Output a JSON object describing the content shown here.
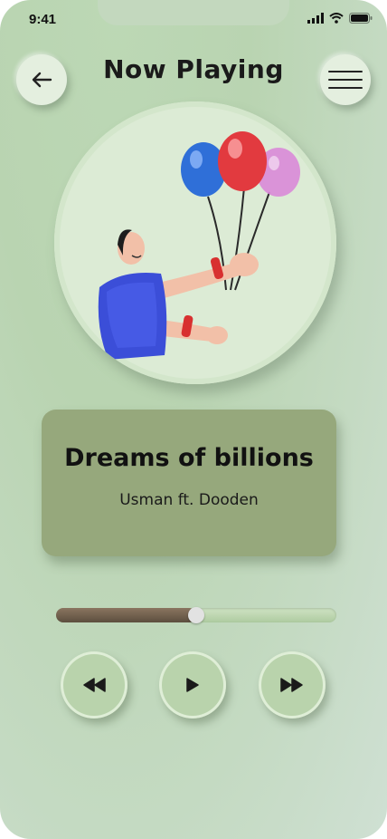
{
  "status_bar": {
    "time": "9:41",
    "icons": [
      "cellular-signal-icon",
      "wifi-icon",
      "battery-icon"
    ]
  },
  "header": {
    "title": "Now Playing",
    "back_icon": "arrow-left-icon",
    "menu_icon": "hamburger-menu-icon"
  },
  "artwork": {
    "description_icon": "balloons-illustration"
  },
  "track": {
    "title": "Dreams of billions",
    "artist": "Usman ft. Dooden"
  },
  "playback": {
    "progress": 0.5
  },
  "controls": {
    "rewind_icon": "rewind-icon",
    "play_icon": "play-icon",
    "forward_icon": "fast-forward-icon"
  },
  "colors": {
    "background": "#bcd8b5",
    "card": "#96a87c",
    "progress_fill": "#5c4e3e",
    "button": "#b9d3ac"
  }
}
